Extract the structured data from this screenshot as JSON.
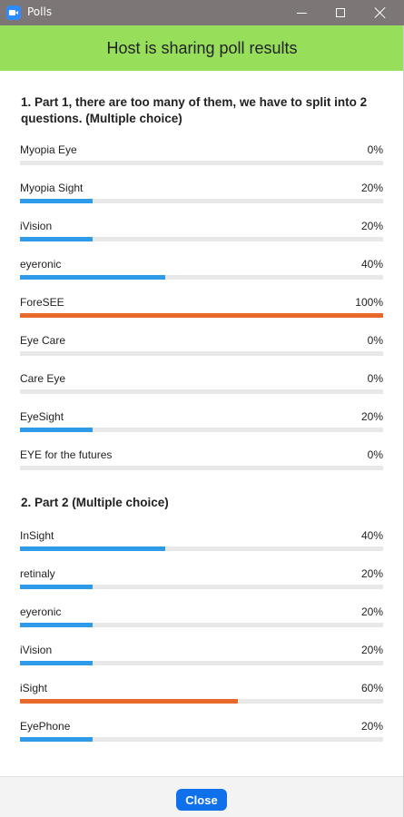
{
  "window": {
    "title": "Polls"
  },
  "banner": {
    "text": "Host is sharing poll results"
  },
  "colors": {
    "normal_bar": "#2e9bea",
    "top_bar": "#e8692a",
    "banner": "#97df5b"
  },
  "questions": [
    {
      "title": "1. Part 1, there are too many of them, we have to split into 2 questions. (Multiple choice)",
      "options": [
        {
          "label": "Myopia Eye",
          "percent_text": "0%",
          "value": 0,
          "highlight": false
        },
        {
          "label": "Myopia Sight",
          "percent_text": "20%",
          "value": 20,
          "highlight": false
        },
        {
          "label": "iVision",
          "percent_text": "20%",
          "value": 20,
          "highlight": false
        },
        {
          "label": "eyeronic",
          "percent_text": "40%",
          "value": 40,
          "highlight": false
        },
        {
          "label": "ForeSEE",
          "percent_text": "100%",
          "value": 100,
          "highlight": true
        },
        {
          "label": "Eye Care",
          "percent_text": "0%",
          "value": 0,
          "highlight": false
        },
        {
          "label": "Care Eye",
          "percent_text": "0%",
          "value": 0,
          "highlight": false
        },
        {
          "label": "EyeSight",
          "percent_text": "20%",
          "value": 20,
          "highlight": false
        },
        {
          "label": "EYE for the futures",
          "percent_text": "0%",
          "value": 0,
          "highlight": false
        }
      ]
    },
    {
      "title": "2. Part 2 (Multiple choice)",
      "options": [
        {
          "label": "InSight",
          "percent_text": "40%",
          "value": 40,
          "highlight": false
        },
        {
          "label": "retinaly",
          "percent_text": "20%",
          "value": 20,
          "highlight": false
        },
        {
          "label": "eyeronic",
          "percent_text": "20%",
          "value": 20,
          "highlight": false
        },
        {
          "label": "iVision",
          "percent_text": "20%",
          "value": 20,
          "highlight": false
        },
        {
          "label": "iSight",
          "percent_text": "60%",
          "value": 60,
          "highlight": true
        },
        {
          "label": "EyePhone",
          "percent_text": "20%",
          "value": 20,
          "highlight": false
        }
      ]
    }
  ],
  "footer": {
    "close_label": "Close"
  }
}
